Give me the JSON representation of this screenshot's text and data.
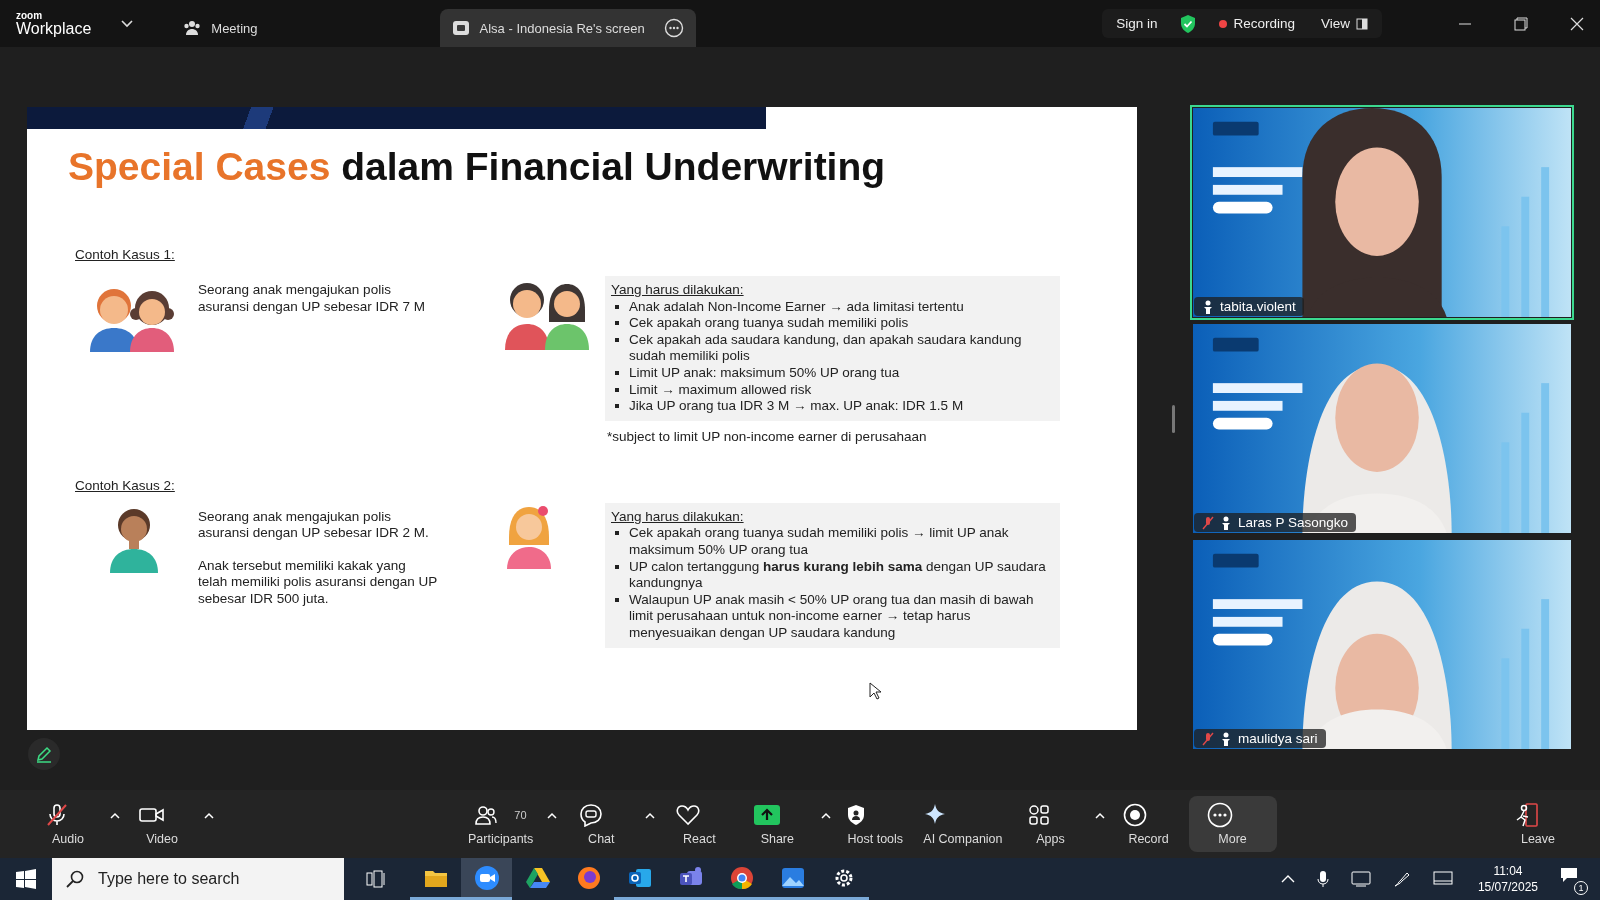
{
  "titlebar": {
    "logo_small": "zoom",
    "logo": "Workplace",
    "tabs": [
      {
        "label": "Meeting",
        "selected": false
      },
      {
        "label": "Alsa - Indonesia Re's screen",
        "selected": true
      }
    ],
    "sign_in": "Sign in",
    "recording": "Recording",
    "view": "View"
  },
  "slide": {
    "title_highlight": "Special Cases",
    "title_rest": "dalam Financial Underwriting",
    "cases": [
      {
        "label": "Contoh Kasus 1:",
        "description": [
          "Seorang anak mengajukan polis asuransi dengan UP sebesar IDR 7 M"
        ],
        "action_heading": "Yang harus dilakukan:",
        "actions": [
          "Anak adalah Non-Income Earner → ada limitasi tertentu",
          "Cek apakah orang tuanya sudah memiliki polis",
          "Cek apakah ada saudara kandung, dan apakah saudara kandung sudah memiliki polis",
          "Limit UP anak: maksimum 50% UP orang tua",
          "Limit → maximum allowed risk",
          "Jika UP orang tua IDR 3 M → max. UP anak: IDR 1.5 M"
        ],
        "footnote": "*subject to limit UP non-income earner di perusahaan"
      },
      {
        "label": "Contoh Kasus 2:",
        "description": [
          "Seorang anak mengajukan polis asuransi dengan UP sebesar IDR 2 M.",
          "Anak tersebut memiliki kakak yang telah memiliki polis asuransi dengan UP sebesar IDR 500 juta."
        ],
        "action_heading": "Yang harus dilakukan:",
        "actions": [
          "Cek apakah orang tuanya sudah memiliki polis → limit UP anak maksimum 50% UP orang tua",
          "UP calon tertanggung **harus kurang lebih sama** dengan UP saudara kandungnya",
          "Walaupun UP anak masih < 50% UP orang tua dan masih di bawah limit perusahaan untuk non-income earner → tetap harus menyesuaikan dengan UP saudara kandung"
        ]
      }
    ]
  },
  "participants": [
    {
      "name": "tabita.violent",
      "muted": false,
      "speaking": true
    },
    {
      "name": "Laras P Sasongko",
      "muted": true,
      "speaking": false
    },
    {
      "name": "maulidya sari",
      "muted": true,
      "speaking": false
    }
  ],
  "toolbar": {
    "audio_muted": true,
    "items": [
      {
        "kind": "audio",
        "label": "Audio",
        "caret": true,
        "selected": false
      },
      {
        "kind": "video",
        "label": "Video",
        "caret": true,
        "selected": false
      },
      {
        "kind": "participants",
        "label": "Participants",
        "count": "70",
        "caret": true,
        "selected": false
      },
      {
        "kind": "chat",
        "label": "Chat",
        "caret": true,
        "selected": false
      },
      {
        "kind": "react",
        "label": "React",
        "caret": false,
        "selected": false
      },
      {
        "kind": "share",
        "label": "Share",
        "caret": true,
        "selected": false
      },
      {
        "kind": "host",
        "label": "Host tools",
        "caret": false,
        "selected": false
      },
      {
        "kind": "ai",
        "label": "AI Companion",
        "caret": false,
        "selected": false
      },
      {
        "kind": "apps",
        "label": "Apps",
        "caret": true,
        "selected": false
      },
      {
        "kind": "record",
        "label": "Record",
        "caret": false,
        "selected": false
      },
      {
        "kind": "more",
        "label": "More",
        "caret": false,
        "selected": true
      },
      {
        "kind": "leave",
        "label": "Leave",
        "caret": false,
        "selected": false
      }
    ]
  },
  "taskbar": {
    "search": {
      "placeholder": "Type here to search"
    },
    "apps": [
      {
        "kind": "explorer",
        "running": true,
        "selected": false
      },
      {
        "kind": "zoom",
        "running": true,
        "selected": true
      },
      {
        "kind": "drive",
        "running": false,
        "selected": false
      },
      {
        "kind": "firefox",
        "running": false,
        "selected": false
      },
      {
        "kind": "outlook",
        "running": true,
        "selected": false
      },
      {
        "kind": "teams",
        "running": true,
        "selected": false
      },
      {
        "kind": "chrome",
        "running": true,
        "selected": false
      },
      {
        "kind": "photos",
        "running": true,
        "selected": false
      },
      {
        "kind": "settings",
        "running": true,
        "selected": false
      }
    ],
    "time": "11:04",
    "date": "15/07/2025",
    "notifications": "1"
  }
}
